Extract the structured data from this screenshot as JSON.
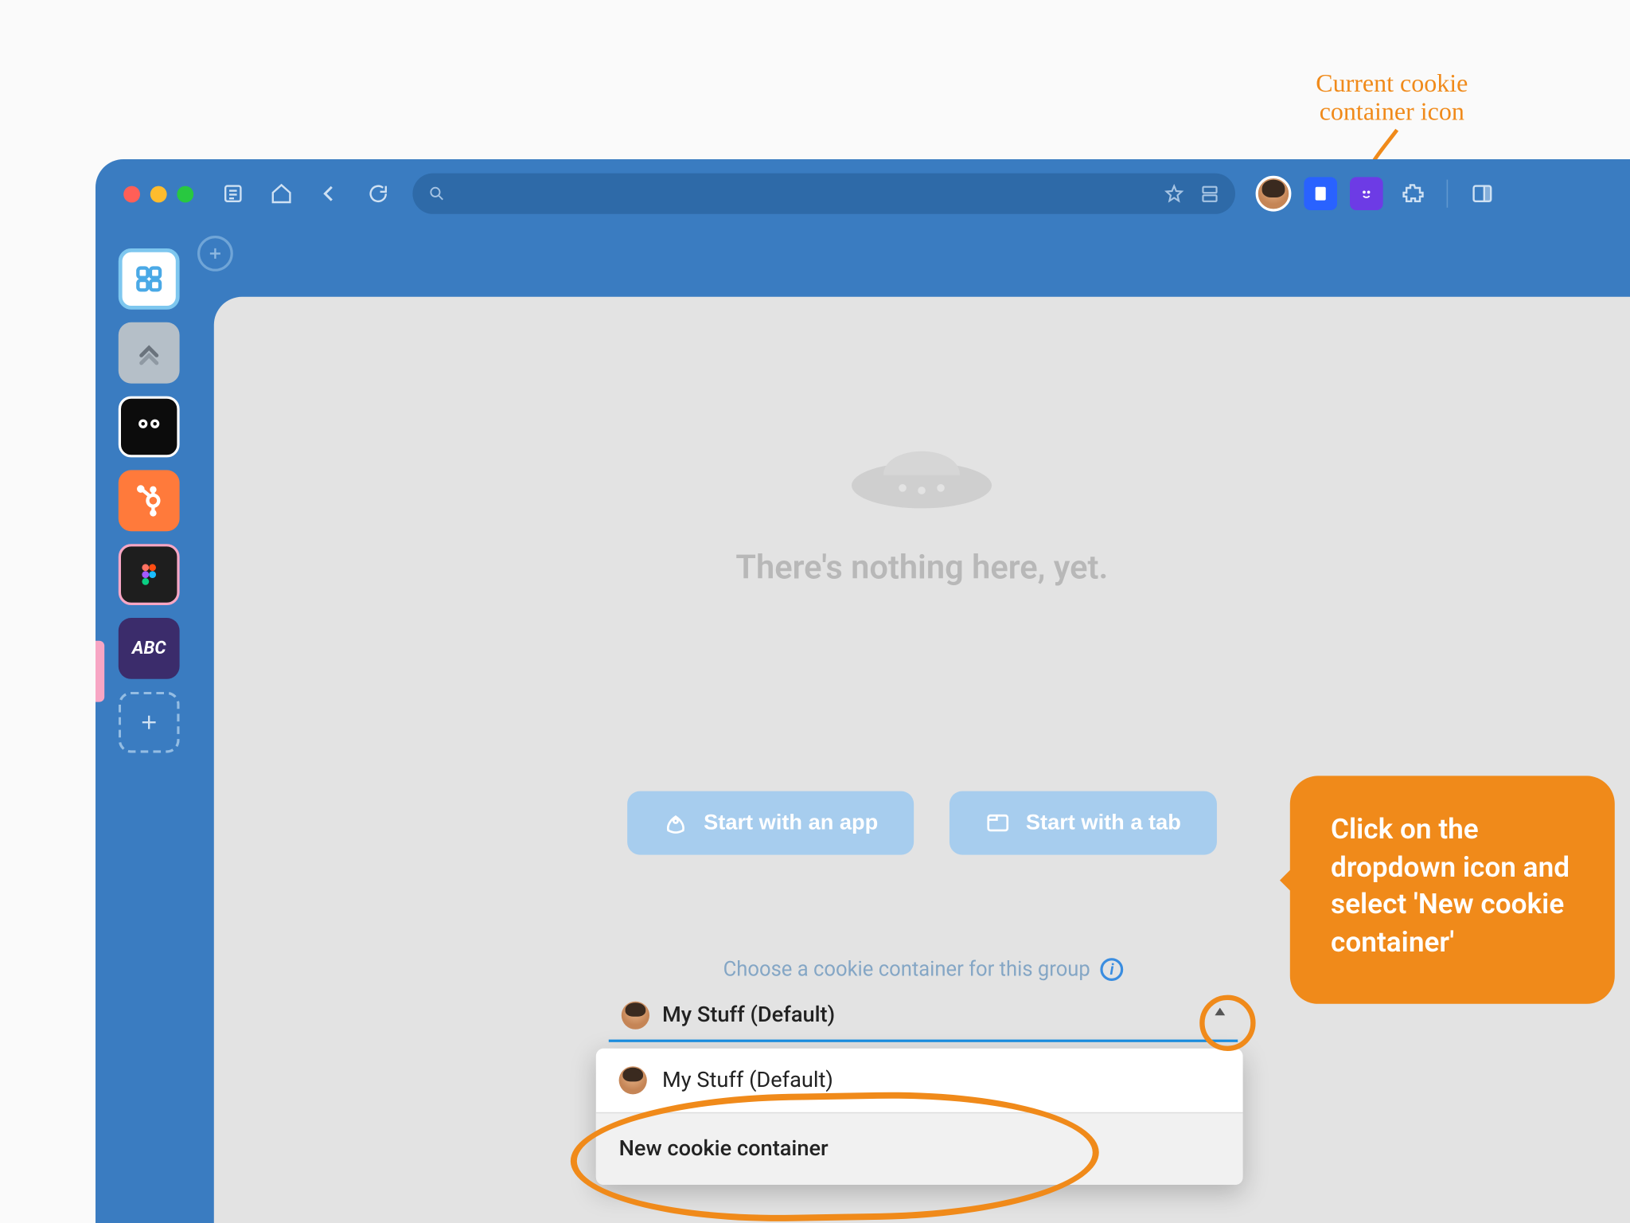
{
  "annotations": {
    "top_label_line1": "Current cookie",
    "top_label_line2": "container icon",
    "callout": "Click on the dropdown icon and select 'New cookie container'"
  },
  "toolbar": {
    "icons": {
      "list": "list-icon",
      "home": "home-icon",
      "back": "chevron-left-icon",
      "reload": "reload-icon",
      "search": "search-icon",
      "star": "star-icon",
      "group": "layout-group-icon",
      "avatar": "user-avatar",
      "doc_ext": "docs-extension",
      "smile_ext": "smile-extension",
      "puzzle": "extensions-icon",
      "panel": "side-panel-icon"
    }
  },
  "sidebar": {
    "items": [
      {
        "name": "apps-grid"
      },
      {
        "name": "clickup"
      },
      {
        "name": "hootsuite"
      },
      {
        "name": "hubspot"
      },
      {
        "name": "figma"
      },
      {
        "name": "abc-app",
        "label": "ABC"
      },
      {
        "name": "add-app"
      }
    ]
  },
  "content": {
    "empty_text": "There's nothing here, yet.",
    "cta_app": "Start with an app",
    "cta_tab": "Start with a tab",
    "chooser_label": "Choose a cookie container for this group",
    "selected": "My Stuff (Default)",
    "options": {
      "0": "My Stuff (Default)",
      "1": "New cookie container"
    }
  }
}
